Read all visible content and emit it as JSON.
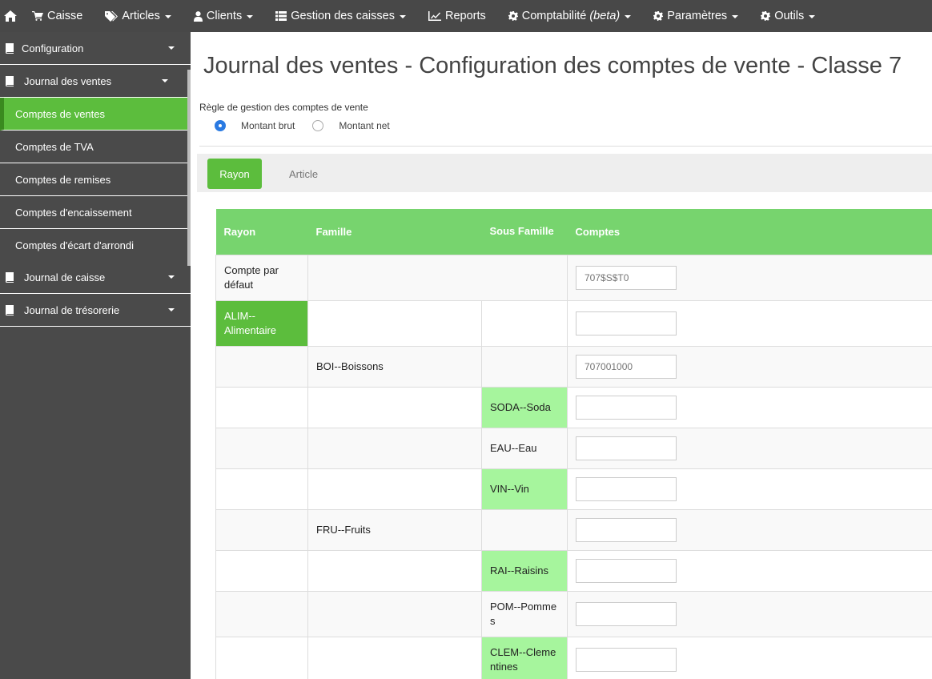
{
  "nav": {
    "items": [
      {
        "label": "Caisse",
        "icon": "cart-icon",
        "caret": false
      },
      {
        "label": "Articles",
        "icon": "tags-icon",
        "caret": true
      },
      {
        "label": "Clients",
        "icon": "user-icon",
        "caret": true
      },
      {
        "label": "Gestion des caisses",
        "icon": "list-icon",
        "caret": true
      },
      {
        "label": "Reports",
        "icon": "line-chart-icon",
        "caret": false
      },
      {
        "label": "Comptabilité",
        "suffix": "(beta)",
        "icon": "cog-icon",
        "caret": true
      },
      {
        "label": "Paramètres",
        "icon": "cog-icon",
        "caret": true
      },
      {
        "label": "Outils",
        "icon": "cog-icon",
        "caret": true
      }
    ]
  },
  "sidebar": {
    "configuration": "Configuration",
    "journal_ventes": "Journal des ventes",
    "sub_items": [
      "Comptes de ventes",
      "Comptes de TVA",
      "Comptes de remises",
      "Comptes d'encaissement",
      "Comptes d'écart d'arrondi"
    ],
    "journal_caisse": "Journal de caisse",
    "journal_tresorerie": "Journal de trésorerie"
  },
  "page": {
    "title": "Journal des ventes - Configuration des comptes de vente - Classe 7",
    "rule_label": "Règle de gestion des comptes de vente",
    "radio_brut": "Montant brut",
    "radio_net": "Montant net",
    "selected_rule": "Montant brut"
  },
  "tabs": {
    "rayon": "Rayon",
    "article": "Article",
    "active": "Rayon"
  },
  "table": {
    "headers": {
      "rayon": "Rayon",
      "famille": "Famille",
      "sous_famille": "Sous Famille",
      "comptes": "Comptes"
    },
    "default_row": {
      "label": "Compte par défaut",
      "account_placeholder": "707$S$T0"
    },
    "rows": [
      {
        "rayon": "ALIM--Alimentaire",
        "famille": "",
        "sous_famille": "",
        "account": "",
        "placeholder": ""
      },
      {
        "rayon": "",
        "famille": "BOI--Boissons",
        "sous_famille": "",
        "account": "",
        "placeholder": "707001000"
      },
      {
        "rayon": "",
        "famille": "",
        "sous_famille": "SODA--Soda",
        "account": "",
        "placeholder": ""
      },
      {
        "rayon": "",
        "famille": "",
        "sous_famille": "EAU--Eau",
        "account": "",
        "placeholder": ""
      },
      {
        "rayon": "",
        "famille": "",
        "sous_famille": "VIN--Vin",
        "account": "",
        "placeholder": ""
      },
      {
        "rayon": "",
        "famille": "FRU--Fruits",
        "sous_famille": "",
        "account": "",
        "placeholder": ""
      },
      {
        "rayon": "",
        "famille": "",
        "sous_famille": "RAI--Raisins",
        "account": "",
        "placeholder": ""
      },
      {
        "rayon": "",
        "famille": "",
        "sous_famille": "POM--Pommes",
        "account": "",
        "placeholder": ""
      },
      {
        "rayon": "",
        "famille": "",
        "sous_famille": "CLEM--Clementines",
        "account": "",
        "placeholder": ""
      }
    ]
  },
  "colors": {
    "nav_bg": "#484848",
    "sidebar_bg": "#4a4a4a",
    "accent": "#5cbd3d",
    "header_green": "#77d46e",
    "famille_green": "#7ef21a",
    "sf_green": "#a6f59d"
  }
}
